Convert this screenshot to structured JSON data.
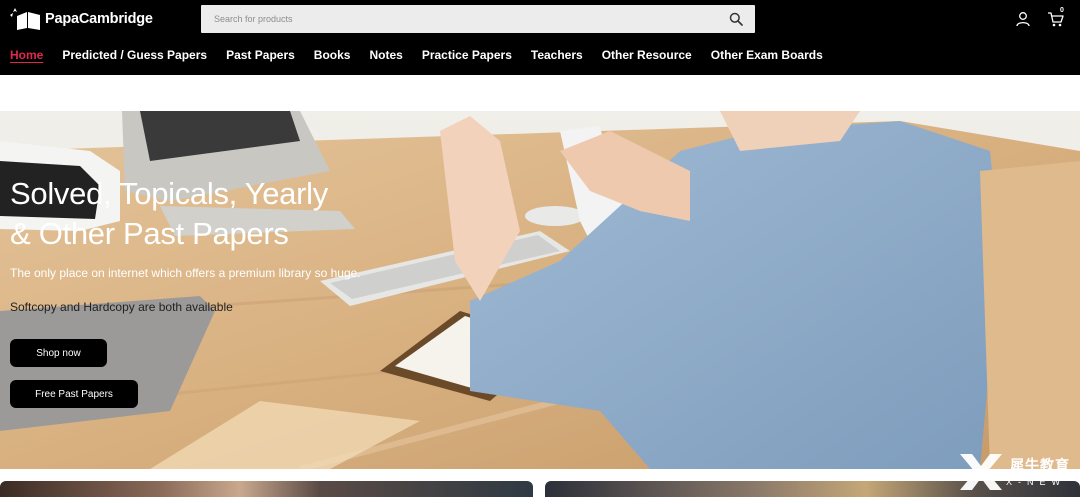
{
  "header": {
    "logo_text": "PapaCambridge",
    "search": {
      "placeholder": "Search for products",
      "value": ""
    },
    "cart_count": "0"
  },
  "nav": [
    {
      "label": "Home",
      "active": true
    },
    {
      "label": "Predicted / Guess Papers",
      "active": false
    },
    {
      "label": "Past Papers",
      "active": false
    },
    {
      "label": "Books",
      "active": false
    },
    {
      "label": "Notes",
      "active": false
    },
    {
      "label": "Practice Papers",
      "active": false
    },
    {
      "label": "Teachers",
      "active": false
    },
    {
      "label": "Other Resource",
      "active": false
    },
    {
      "label": "Other Exam Boards",
      "active": false
    }
  ],
  "hero": {
    "title_line1": "Solved, Topicals, Yearly",
    "title_line2": "& Other Past Papers",
    "subtitle": "The only place on internet which offers a premium library so huge.",
    "subtitle2": "Softcopy and Hardcopy are both available",
    "shop_button": "Shop now",
    "free_button": "Free Past Papers"
  },
  "watermark": {
    "text": "犀牛教育",
    "sub": "X-NEW"
  },
  "colors": {
    "accent": "#e0284f",
    "header_bg": "#000000",
    "search_bg": "#ececec"
  },
  "icons": [
    "logo-icon",
    "search-icon",
    "user-icon",
    "cart-icon"
  ]
}
